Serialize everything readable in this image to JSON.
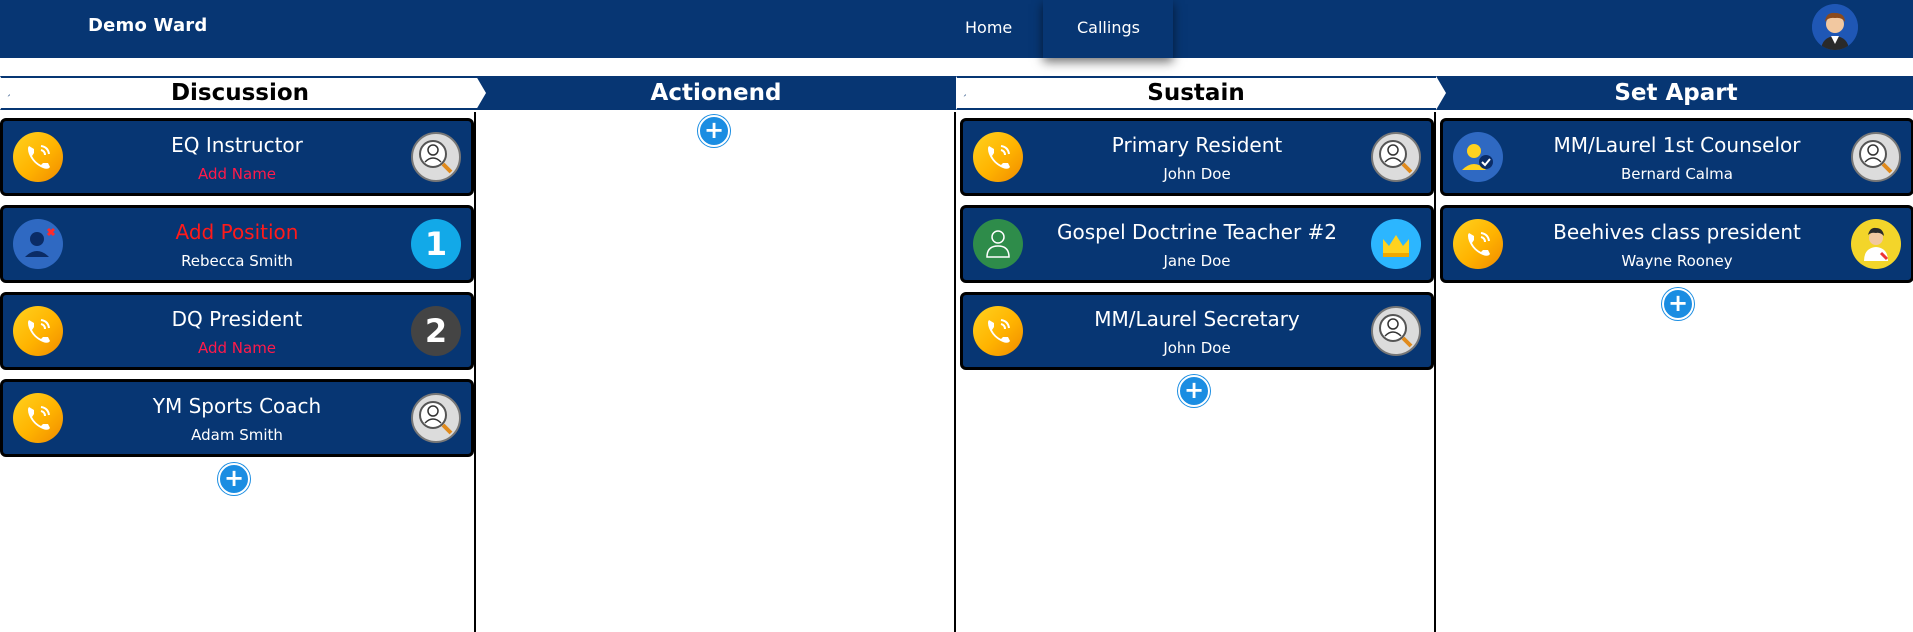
{
  "app": {
    "brand": "Demo Ward",
    "nav": {
      "home": "Home",
      "callings": "Callings"
    }
  },
  "columns": [
    {
      "title": "Discussion",
      "cards": [
        {
          "position": "EQ Instructor",
          "name": "Add Name",
          "left_icon": "phone-icon",
          "right_icon": "search-person-icon"
        },
        {
          "position": "Add Position",
          "name": "Rebecca Smith",
          "left_icon": "user-remove-icon",
          "right_icon": "number-1-icon",
          "right_text": "1"
        },
        {
          "position": "DQ President",
          "name": "Add Name",
          "left_icon": "phone-icon",
          "right_icon": "number-2-icon",
          "right_text": "2"
        },
        {
          "position": "YM Sports Coach",
          "name": "Adam Smith",
          "left_icon": "phone-icon",
          "right_icon": "search-person-icon"
        }
      ]
    },
    {
      "title": "Action",
      "cards": []
    },
    {
      "title": "Sustain",
      "cards": [
        {
          "position": "Primary Resident",
          "name": "John Doe",
          "left_icon": "phone-icon",
          "right_icon": "search-person-icon"
        },
        {
          "position": "Gospel Doctrine Teacher #2",
          "name": "Jane Doe",
          "left_icon": "green-user-icon",
          "right_icon": "crown-icon"
        },
        {
          "position": "MM/Laurel Secretary",
          "name": "John Doe",
          "left_icon": "phone-icon",
          "right_icon": "search-person-icon"
        }
      ]
    },
    {
      "title": "Set Apart",
      "cards": [
        {
          "position": "MM/Laurel 1st Counselor",
          "name": "Bernard Calma",
          "left_icon": "user-check-icon",
          "right_icon": "search-person-icon"
        },
        {
          "position": "Beehives class president",
          "name": "Wayne Rooney",
          "left_icon": "phone-icon",
          "right_icon": "doctor-icon"
        }
      ]
    }
  ],
  "add_button_symbol": "+",
  "colors": {
    "navy": "#073673",
    "warning_red": "#ff1a1a",
    "add_blue": "#1a8de2"
  }
}
